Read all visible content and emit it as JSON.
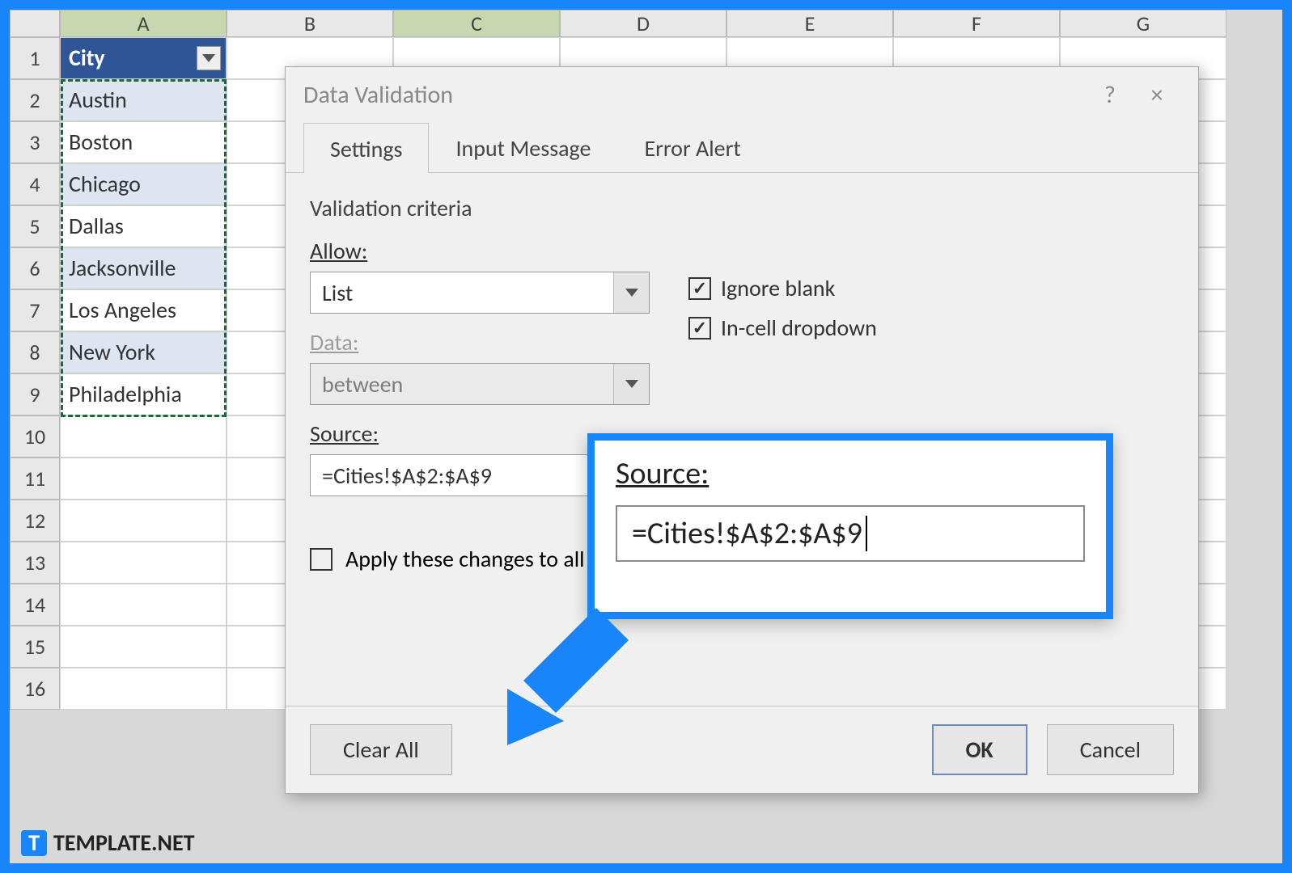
{
  "columns": [
    "A",
    "B",
    "C",
    "D",
    "E",
    "F",
    "G"
  ],
  "rows": [
    "1",
    "2",
    "3",
    "4",
    "5",
    "6",
    "7",
    "8",
    "9",
    "10",
    "11",
    "12",
    "13",
    "14",
    "15",
    "16"
  ],
  "table": {
    "header": "City",
    "items": [
      "Austin",
      "Boston",
      "Chicago",
      "Dallas",
      "Jacksonville",
      "Los Angeles",
      "New York",
      "Philadelphia"
    ]
  },
  "dialog": {
    "title": "Data Validation",
    "tabs": {
      "settings": "Settings",
      "input_message": "Input Message",
      "error_alert": "Error Alert"
    },
    "criteria_label": "Validation criteria",
    "allow_label": "Allow:",
    "allow_value": "List",
    "data_label": "Data:",
    "data_value": "between",
    "source_label": "Source:",
    "source_value": "=Cities!$A$2:$A$9",
    "ignore_blank": "Ignore blank",
    "incell_dropdown": "In-cell dropdown",
    "apply_all": "Apply these changes to all other cells with the same settings",
    "clear_all": "Clear All",
    "ok": "OK",
    "cancel": "Cancel",
    "help": "?",
    "close": "×"
  },
  "callout": {
    "label": "Source:",
    "value": "=Cities!$A$2:$A$9"
  },
  "watermark": {
    "icon": "T",
    "text": "TEMPLATE.NET"
  }
}
